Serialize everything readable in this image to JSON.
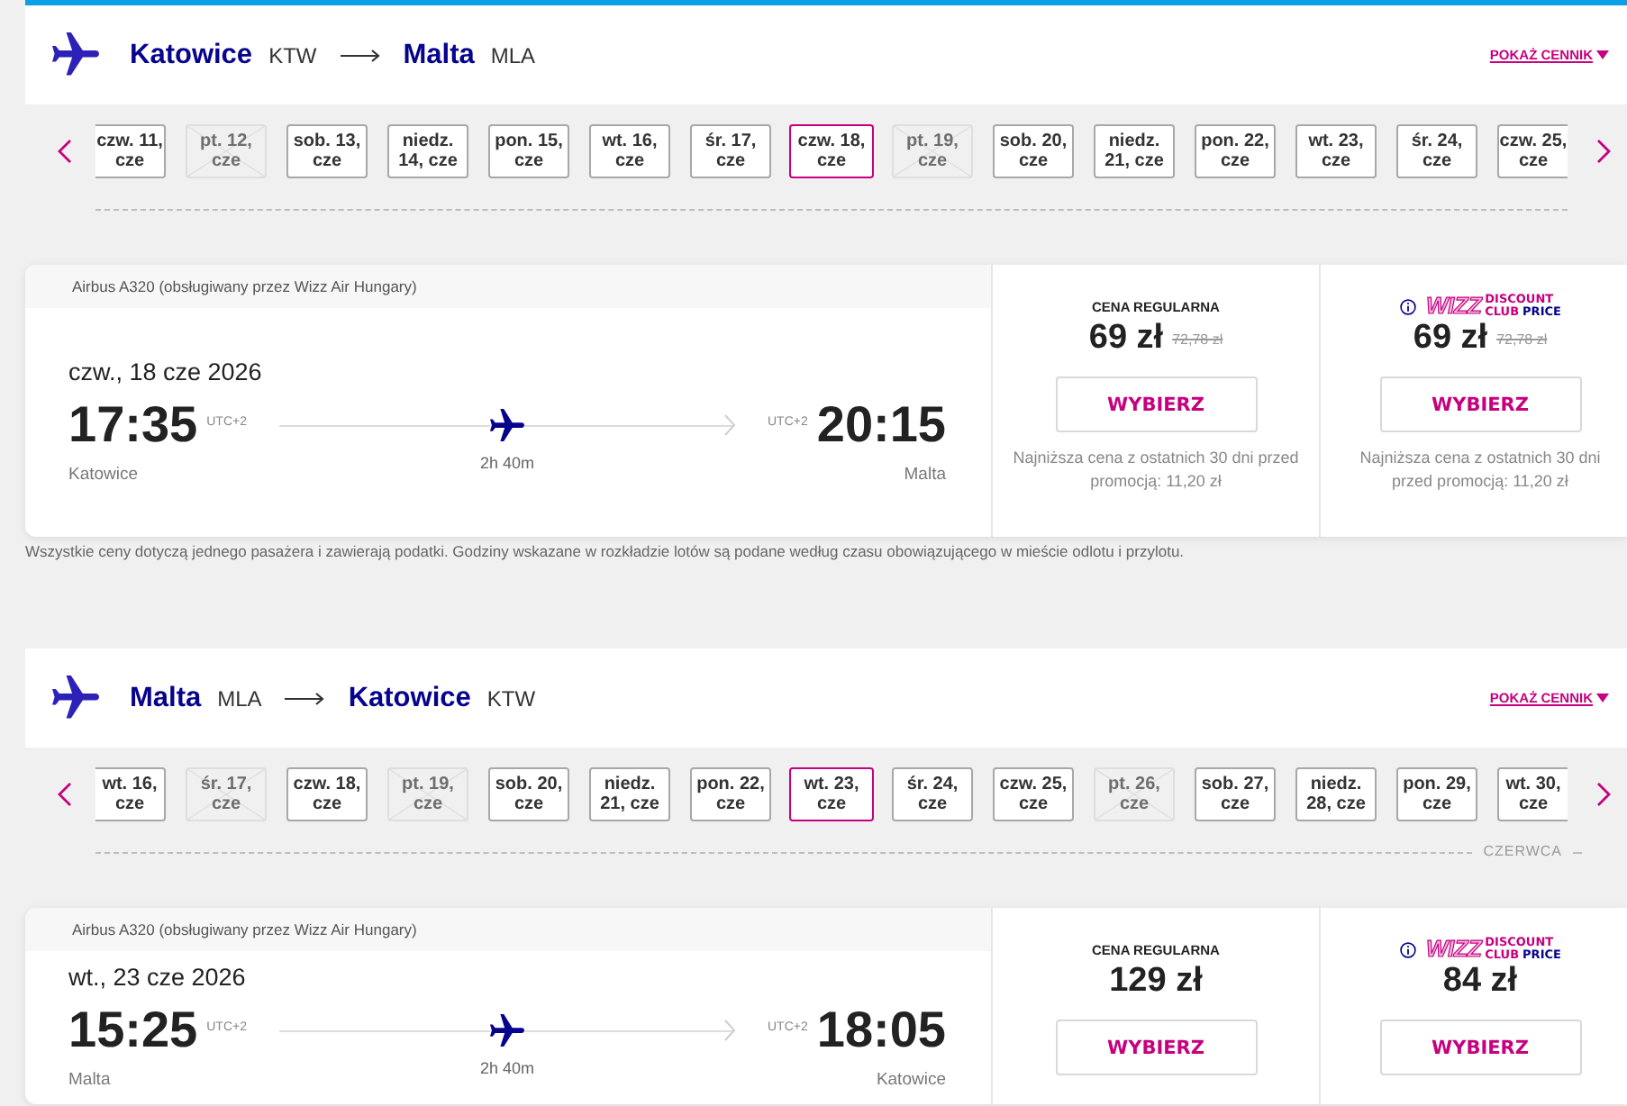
{
  "legs": [
    {
      "header": {
        "origin_city": "Katowice",
        "origin_code": "KTW",
        "destination_city": "Malta",
        "destination_code": "MLA",
        "prices_link": "POKAŻ CENNIK"
      },
      "dates": [
        {
          "label": "czw. 11, cze",
          "selected": false,
          "disabled": false
        },
        {
          "label": "pt. 12, cze",
          "selected": false,
          "disabled": true
        },
        {
          "label": "sob. 13, cze",
          "selected": false,
          "disabled": false
        },
        {
          "label": "niedz. 14, cze",
          "selected": false,
          "disabled": false
        },
        {
          "label": "pon. 15, cze",
          "selected": false,
          "disabled": false
        },
        {
          "label": "wt. 16, cze",
          "selected": false,
          "disabled": false
        },
        {
          "label": "śr. 17, cze",
          "selected": false,
          "disabled": false
        },
        {
          "label": "czw. 18, cze",
          "selected": true,
          "disabled": false
        },
        {
          "label": "pt. 19, cze",
          "selected": false,
          "disabled": true
        },
        {
          "label": "sob. 20, cze",
          "selected": false,
          "disabled": false
        },
        {
          "label": "niedz. 21, cze",
          "selected": false,
          "disabled": false
        },
        {
          "label": "pon. 22, cze",
          "selected": false,
          "disabled": false
        },
        {
          "label": "wt. 23, cze",
          "selected": false,
          "disabled": false
        },
        {
          "label": "śr. 24, cze",
          "selected": false,
          "disabled": false
        },
        {
          "label": "czw. 25, cze",
          "selected": false,
          "disabled": false
        }
      ],
      "flight": {
        "aircraft": "Airbus A320 (obsługiwany przez Wizz Air Hungary)",
        "date": "czw., 18 cze 2026",
        "departure_time": "17:35",
        "departure_tz": "UTC+2",
        "arrival_tz": "UTC+2",
        "arrival_time": "20:15",
        "origin": "Katowice",
        "duration": "2h 40m",
        "destination": "Malta"
      },
      "fares": [
        {
          "kind": "regular",
          "label": "CENA REGULARNA",
          "price": "69 zł",
          "old_price": "72,78 zł",
          "button": "WYBIERZ",
          "note": "Najniższa cena z ostatnich 30 dni przed promocją: 11,20 zł"
        },
        {
          "kind": "club",
          "logo": {
            "wordmark": "WIZZ",
            "line_1": "DISCOUNT",
            "line_2": "CLUB",
            "line_2_accent": "PRICE"
          },
          "price": "69 zł",
          "old_price": "72,78 zł",
          "button": "WYBIERZ",
          "note": "Najniższa cena z ostatnich 30 dni przed promocją: 11,20 zł"
        }
      ],
      "footnote": "Wszystkie ceny dotyczą jednego pasażera i zawierają podatki. Godziny wskazane w rozkładzie lotów są podane według czasu obowiązującego w mieście odlotu i przylotu."
    },
    {
      "header": {
        "origin_city": "Malta",
        "origin_code": "MLA",
        "destination_city": "Katowice",
        "destination_code": "KTW",
        "prices_link": "POKAŻ CENNIK"
      },
      "dates": [
        {
          "label": "wt. 16, cze",
          "selected": false,
          "disabled": false
        },
        {
          "label": "śr. 17, cze",
          "selected": false,
          "disabled": true
        },
        {
          "label": "czw. 18, cze",
          "selected": false,
          "disabled": false
        },
        {
          "label": "pt. 19, cze",
          "selected": false,
          "disabled": true
        },
        {
          "label": "sob. 20, cze",
          "selected": false,
          "disabled": false
        },
        {
          "label": "niedz. 21, cze",
          "selected": false,
          "disabled": false
        },
        {
          "label": "pon. 22, cze",
          "selected": false,
          "disabled": false
        },
        {
          "label": "wt. 23, cze",
          "selected": true,
          "disabled": false
        },
        {
          "label": "śr. 24, cze",
          "selected": false,
          "disabled": false
        },
        {
          "label": "czw. 25, cze",
          "selected": false,
          "disabled": false
        },
        {
          "label": "pt. 26, cze",
          "selected": false,
          "disabled": true
        },
        {
          "label": "sob. 27, cze",
          "selected": false,
          "disabled": false
        },
        {
          "label": "niedz. 28, cze",
          "selected": false,
          "disabled": false
        },
        {
          "label": "pon. 29, cze",
          "selected": false,
          "disabled": false
        },
        {
          "label": "wt. 30, cze",
          "selected": false,
          "disabled": false
        }
      ],
      "month_label": "CZERWCA",
      "flight": {
        "aircraft": "Airbus A320 (obsługiwany przez Wizz Air Hungary)",
        "date": "wt., 23 cze 2026",
        "departure_time": "15:25",
        "departure_tz": "UTC+2",
        "arrival_tz": "UTC+2",
        "arrival_time": "18:05",
        "origin": "Malta",
        "duration": "2h 40m",
        "destination": "Katowice"
      },
      "fares": [
        {
          "kind": "regular",
          "label": "CENA REGULARNA",
          "price": "129 zł",
          "button": "WYBIERZ"
        },
        {
          "kind": "club",
          "logo": {
            "wordmark": "WIZZ",
            "line_1": "DISCOUNT",
            "line_2": "CLUB",
            "line_2_accent": "PRICE"
          },
          "price": "84 zł",
          "button": "WYBIERZ"
        }
      ]
    }
  ]
}
